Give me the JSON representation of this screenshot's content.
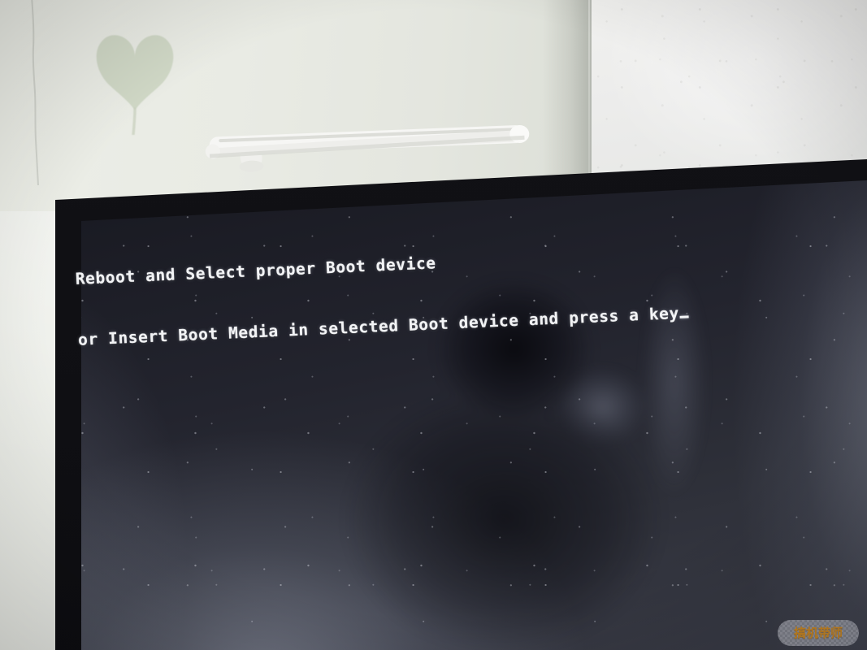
{
  "scene": {
    "kind": "photo-of-monitor",
    "description": "Photograph of a desktop monitor displaying a BIOS boot-device error message"
  },
  "room": {
    "wall_left_color": "#e9ebe4",
    "wall_right_color": "#ececeb",
    "heart_decal_color": "#cdd6c3",
    "heart_decal_name": "heart wall decal",
    "crack_name": "wall seam line"
  },
  "lightbar": {
    "name": "monitor light bar",
    "body_color": "#f4f4f2",
    "shadow_color": "#d8d9d4"
  },
  "monitor": {
    "bezel_color": "#111115",
    "panel_color": "#23242e",
    "reflection_label": "photographer reflection"
  },
  "bios": {
    "line1": "Reboot and Select proper Boot device",
    "line2": "or Insert Boot Media in selected Boot device and press a key",
    "cursor": "_",
    "text_color": "#f2f3f5",
    "background_color": "#15161d"
  },
  "watermark": {
    "text": "搞机带师",
    "color": "#d98f1f",
    "style": "checkerboard-backed sticker"
  }
}
